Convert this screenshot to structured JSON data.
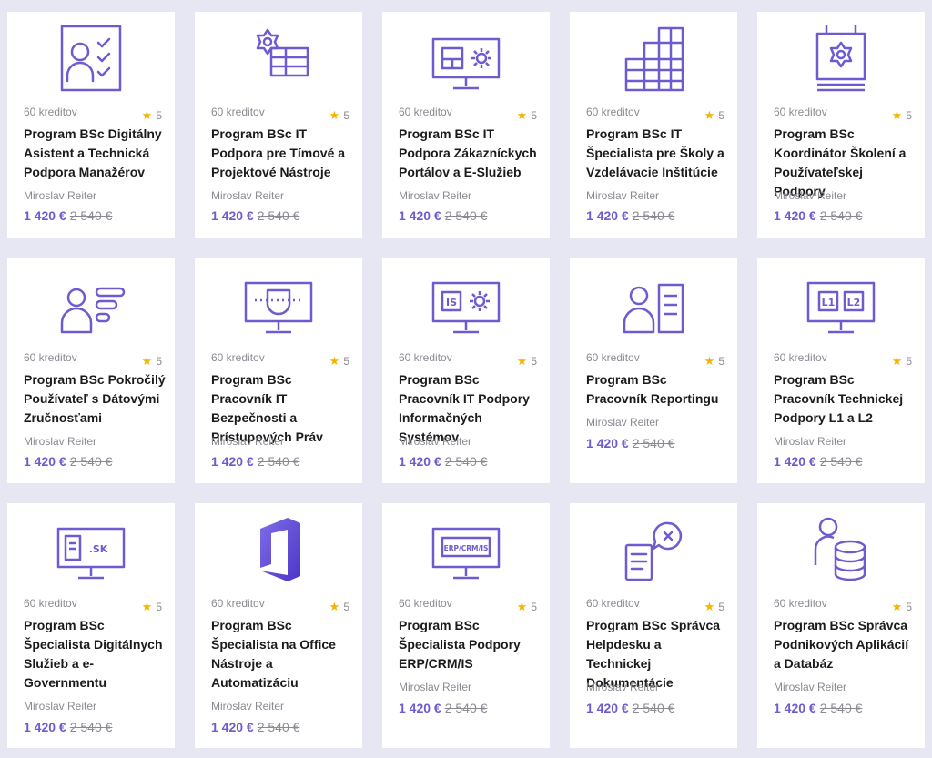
{
  "accent": "#6d5bd0",
  "star_color": "#f4b400",
  "cards": [
    {
      "credits": "60 kreditov",
      "rating": "5",
      "title": "Program BSc Digitálny Asistent a Technická Podpora Manažérov",
      "author": "Miroslav Reiter",
      "price_new": "1 420 €",
      "price_old": "2 540 €",
      "icon": "checklist-person-icon"
    },
    {
      "credits": "60 kreditov",
      "rating": "5",
      "title": "Program BSc IT Podpora pre Tímové a Projektové Nástroje",
      "author": "Miroslav Reiter",
      "price_new": "1 420 €",
      "price_old": "2 540 €",
      "icon": "gear-table-icon"
    },
    {
      "credits": "60 kreditov",
      "rating": "5",
      "title": "Program BSc IT Podpora Zákazníckych Portálov a E-Služieb",
      "author": "Miroslav Reiter",
      "price_new": "1 420 €",
      "price_old": "2 540 €",
      "icon": "monitor-gear-icon"
    },
    {
      "credits": "60 kreditov",
      "rating": "5",
      "title": "Program BSc IT Špecialista pre Školy a Vzdelávacie Inštitúcie",
      "author": "Miroslav Reiter",
      "price_new": "1 420 €",
      "price_old": "2 540 €",
      "icon": "grid-chart-icon"
    },
    {
      "credits": "60 kreditov",
      "rating": "5",
      "title": "Program BSc Koordinátor Školení a Používateľskej Podpory",
      "author": "Miroslav Reiter",
      "price_new": "1 420 €",
      "price_old": "2 540 €",
      "icon": "gear-board-icon"
    },
    {
      "credits": "60 kreditov",
      "rating": "5",
      "title": "Program BSc Pokročilý Používateľ s Dátovými Zručnosťami",
      "author": "Miroslav Reiter",
      "price_new": "1 420 €",
      "price_old": "2 540 €",
      "icon": "person-bars-icon"
    },
    {
      "credits": "60 kreditov",
      "rating": "5",
      "title": "Program BSc Pracovník IT Bezpečnosti a Prístupových Práv",
      "author": "Miroslav Reiter",
      "price_new": "1 420 €",
      "price_old": "2 540 €",
      "icon": "monitor-shield-icon"
    },
    {
      "credits": "60 kreditov",
      "rating": "5",
      "title": "Program BSc Pracovník IT Podpory Informačných Systémov",
      "author": "Miroslav Reiter",
      "price_new": "1 420 €",
      "price_old": "2 540 €",
      "icon": "monitor-is-gear-icon",
      "icon_text": "IS"
    },
    {
      "credits": "60 kreditov",
      "rating": "5",
      "title": "Program BSc Pracovník Reportingu",
      "author": "Miroslav Reiter",
      "price_new": "1 420 €",
      "price_old": "2 540 €",
      "icon": "person-document-icon"
    },
    {
      "credits": "60 kreditov",
      "rating": "5",
      "title": "Program BSc Pracovník Technickej Podpory L1 a L2",
      "author": "Miroslav Reiter",
      "price_new": "1 420 €",
      "price_old": "2 540 €",
      "icon": "monitor-l1-l2-icon",
      "icon_text": "L1",
      "icon_text2": "L2"
    },
    {
      "credits": "60 kreditov",
      "rating": "5",
      "title": "Program BSc Špecialista Digitálnych Služieb a e-Governmentu",
      "author": "Miroslav Reiter",
      "price_new": "1 420 €",
      "price_old": "2 540 €",
      "icon": "monitor-sk-icon",
      "icon_text": ".SK"
    },
    {
      "credits": "60 kreditov",
      "rating": "5",
      "title": "Program BSc Špecialista na Office Nástroje a Automatizáciu",
      "author": "Miroslav Reiter",
      "price_new": "1 420 €",
      "price_old": "2 540 €",
      "icon": "office-logo-icon"
    },
    {
      "credits": "60 kreditov",
      "rating": "5",
      "title": "Program BSc Špecialista Podpory ERP/CRM/IS",
      "author": "Miroslav Reiter",
      "price_new": "1 420 €",
      "price_old": "2 540 €",
      "icon": "monitor-erp-icon",
      "icon_text": "ERP/CRM/IS"
    },
    {
      "credits": "60 kreditov",
      "rating": "5",
      "title": "Program BSc Správca Helpdesku a Technickej Dokumentácie",
      "author": "Miroslav Reiter",
      "price_new": "1 420 €",
      "price_old": "2 540 €",
      "icon": "document-chat-x-icon"
    },
    {
      "credits": "60 kreditov",
      "rating": "5",
      "title": "Program BSc Správca Podnikových Aplikácií a Databáz",
      "author": "Miroslav Reiter",
      "price_new": "1 420 €",
      "price_old": "2 540 €",
      "icon": "person-database-icon"
    }
  ]
}
